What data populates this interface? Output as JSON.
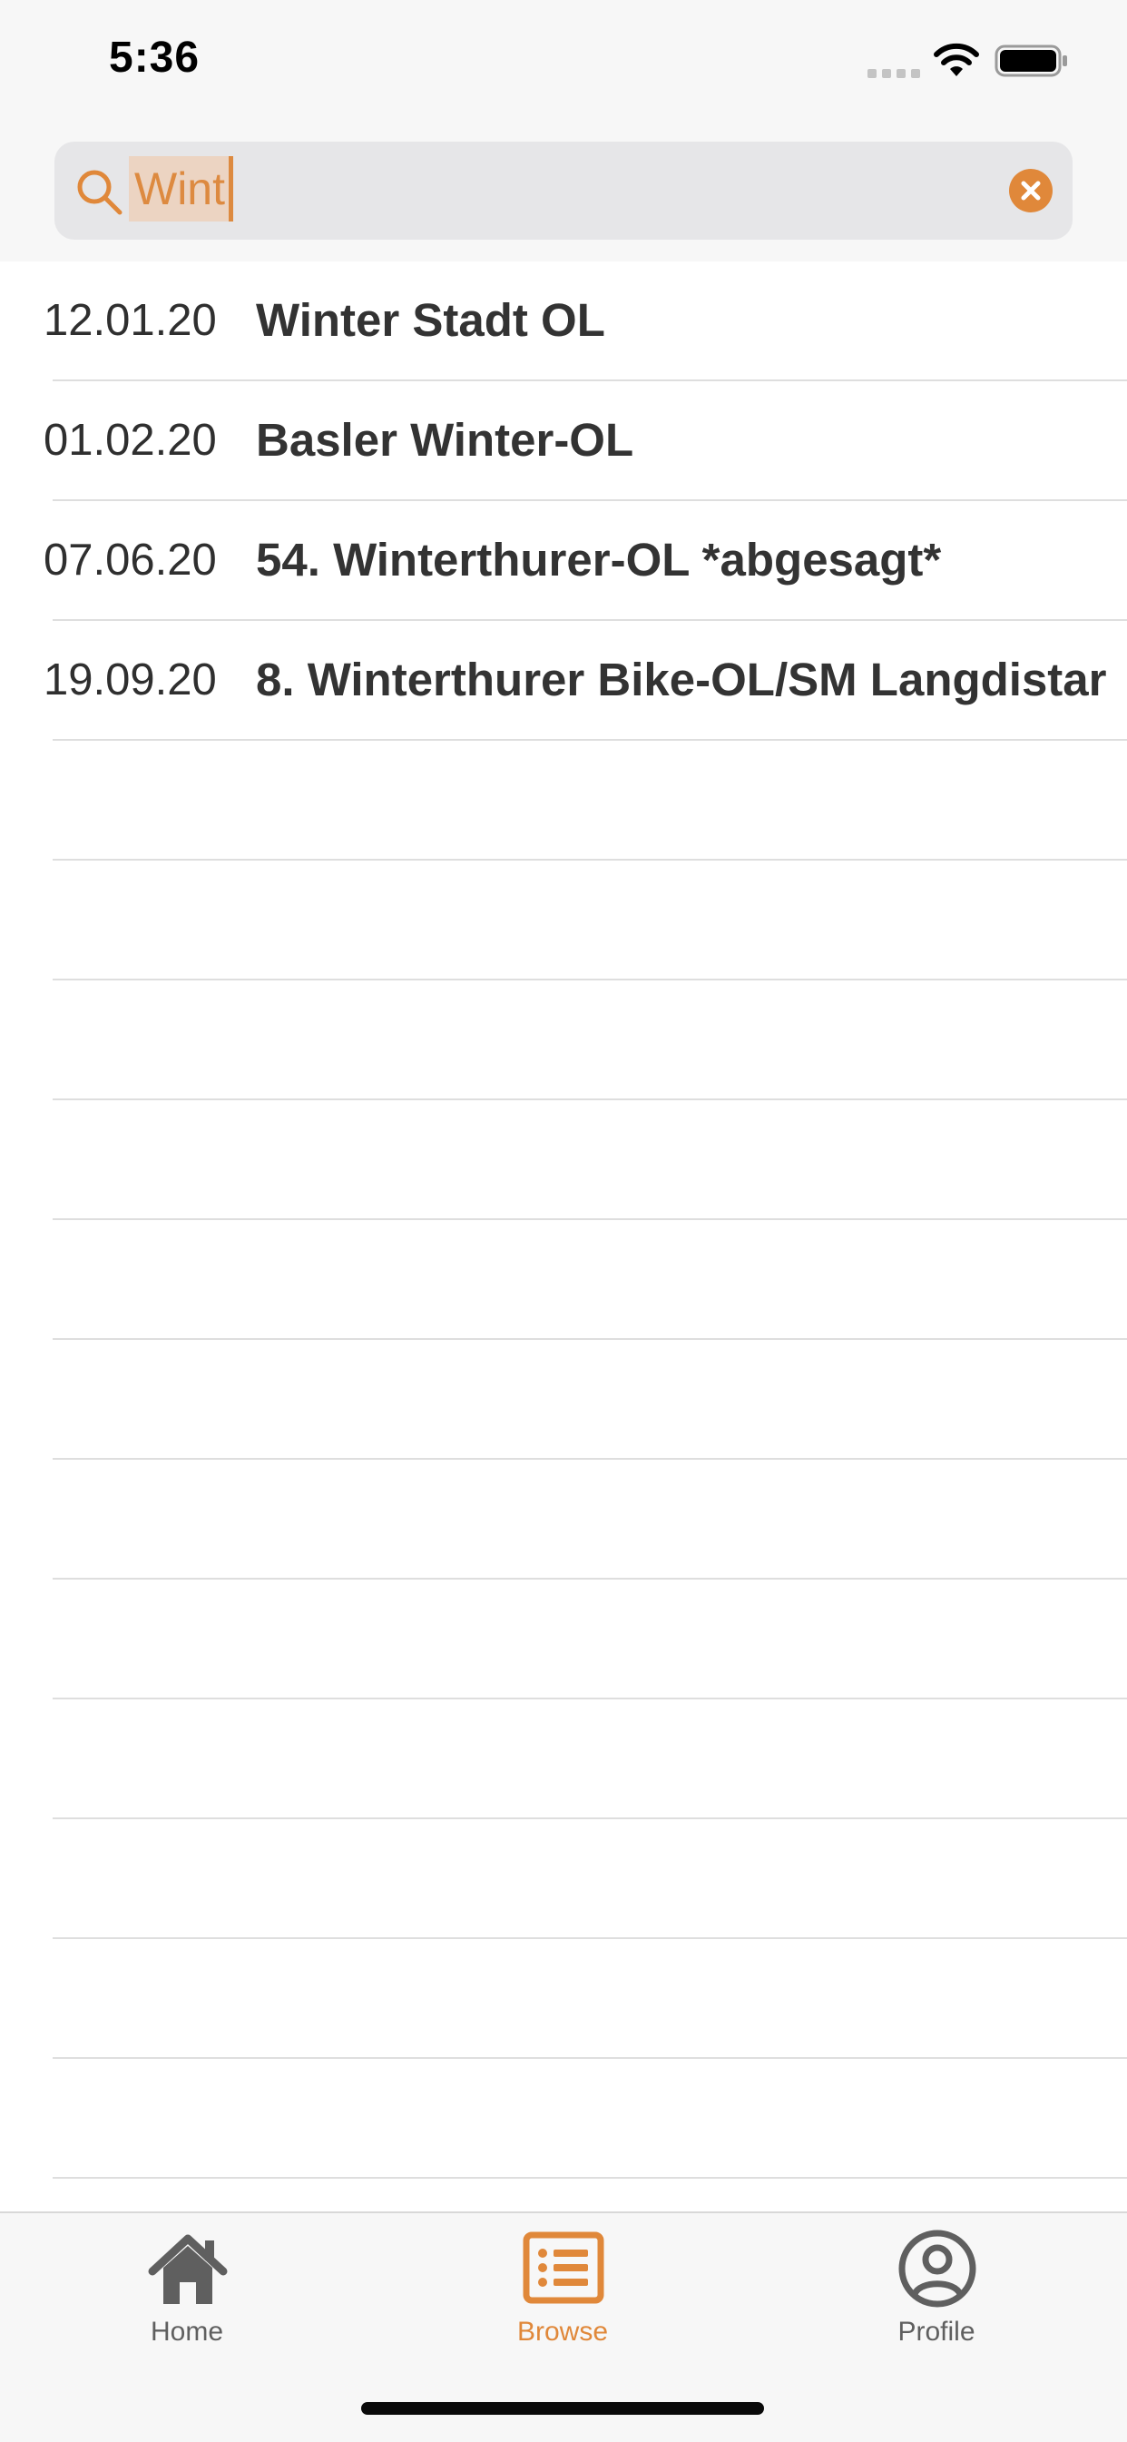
{
  "status_bar": {
    "time": "5:36"
  },
  "search": {
    "value": "Wint",
    "accent_color": "#E0883A"
  },
  "events": [
    {
      "date": "12.01.20",
      "title": "Winter Stadt OL"
    },
    {
      "date": "01.02.20",
      "title": "Basler Winter-OL"
    },
    {
      "date": "07.06.20",
      "title": "54. Winterthurer-OL *abgesagt*"
    },
    {
      "date": "19.09.20",
      "title": "8. Winterthurer Bike-OL/SM Langdistar"
    }
  ],
  "tab_bar": {
    "tabs": [
      {
        "label": "Home",
        "icon": "home-icon",
        "active": false
      },
      {
        "label": "Browse",
        "icon": "list-icon",
        "active": true
      },
      {
        "label": "Profile",
        "icon": "profile-icon",
        "active": false
      }
    ],
    "active_color": "#E0883A",
    "inactive_color": "#5F5F5F"
  }
}
